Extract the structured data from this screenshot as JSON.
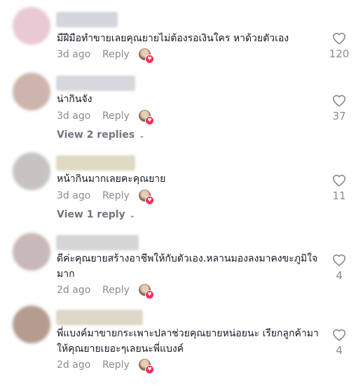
{
  "comments": [
    {
      "text": "มีฝีมือทำขายเลยคุณยายไม่ต้องรอเงินใคร หาด้วยตัวเอง",
      "date": "3d ago",
      "reply_label": "Reply",
      "likes": "120",
      "avatar_color": "#e9c9d3",
      "username_color": "#d3d6dd"
    },
    {
      "text": "น่ากินจัง",
      "date": "3d ago",
      "reply_label": "Reply",
      "likes": "37",
      "view_replies": "View 2 replies",
      "avatar_color": "#cdb5ad",
      "username_color": "#d6d8dc"
    },
    {
      "text": "หน้ากินมากเลยคะคุณยาย",
      "date": "3d ago",
      "reply_label": "Reply",
      "likes": "11",
      "view_replies": "View 1 reply",
      "avatar_color": "#c7c3c2",
      "username_color": "#e0d9c4"
    },
    {
      "text": "ดีค่ะคุณยายสร้างอาชีพให้กับตัวเอง.หลานมองลงมาคงขะภูมิใจมาก",
      "date": "2d ago",
      "reply_label": "Reply",
      "likes": "4",
      "avatar_color": "#c9b8b8",
      "username_color": "#d5d5d8"
    },
    {
      "text": "พี่แบงค์มาขายกระเพาะปลาช่วยคุณยายหน่อยนะ เรียกลูกค้ามาให้คุณยายเยอะๆเลยนะพี่แบงค์",
      "date": "2d ago",
      "reply_label": "Reply",
      "likes": "4",
      "avatar_color": "#b49c8e",
      "username_color": "#ddd8c8"
    }
  ],
  "icons": {
    "like": "heart-outline-icon",
    "creator_liked": "creator-liked-heart-icon",
    "expand": "chevron-down-icon"
  },
  "colors": {
    "muted_text": "#8a8b91",
    "primary_text": "#161823",
    "badge": "#fe2c55"
  }
}
